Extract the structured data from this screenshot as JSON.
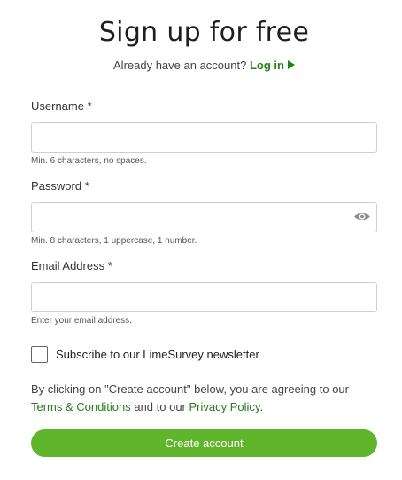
{
  "header": {
    "title": "Sign up for free",
    "login_prompt": "Already have an account?",
    "login_link": "Log in"
  },
  "fields": {
    "username": {
      "label": "Username *",
      "value": "",
      "placeholder": "",
      "hint": "Min. 6 characters, no spaces."
    },
    "password": {
      "label": "Password *",
      "value": "",
      "placeholder": "",
      "hint": "Min. 8 characters, 1 uppercase, 1 number."
    },
    "email": {
      "label": "Email Address *",
      "value": "",
      "placeholder": "",
      "hint": "Enter your email address."
    }
  },
  "newsletter": {
    "label": "Subscribe to our LimeSurvey newsletter",
    "checked": false
  },
  "terms": {
    "prefix": "By clicking on \"Create account\" below, you are agreeing to our",
    "terms_link": "Terms & Conditions",
    "middle": "and to our",
    "privacy_link": "Privacy Policy",
    "suffix": "."
  },
  "submit": {
    "label": "Create account"
  },
  "icons": {
    "login_arrow": "play-icon",
    "password_toggle": "eye-icon"
  },
  "colors": {
    "accent": "#238018",
    "button": "#5fb62c",
    "text": "#333333",
    "border": "#cfcfcf"
  }
}
